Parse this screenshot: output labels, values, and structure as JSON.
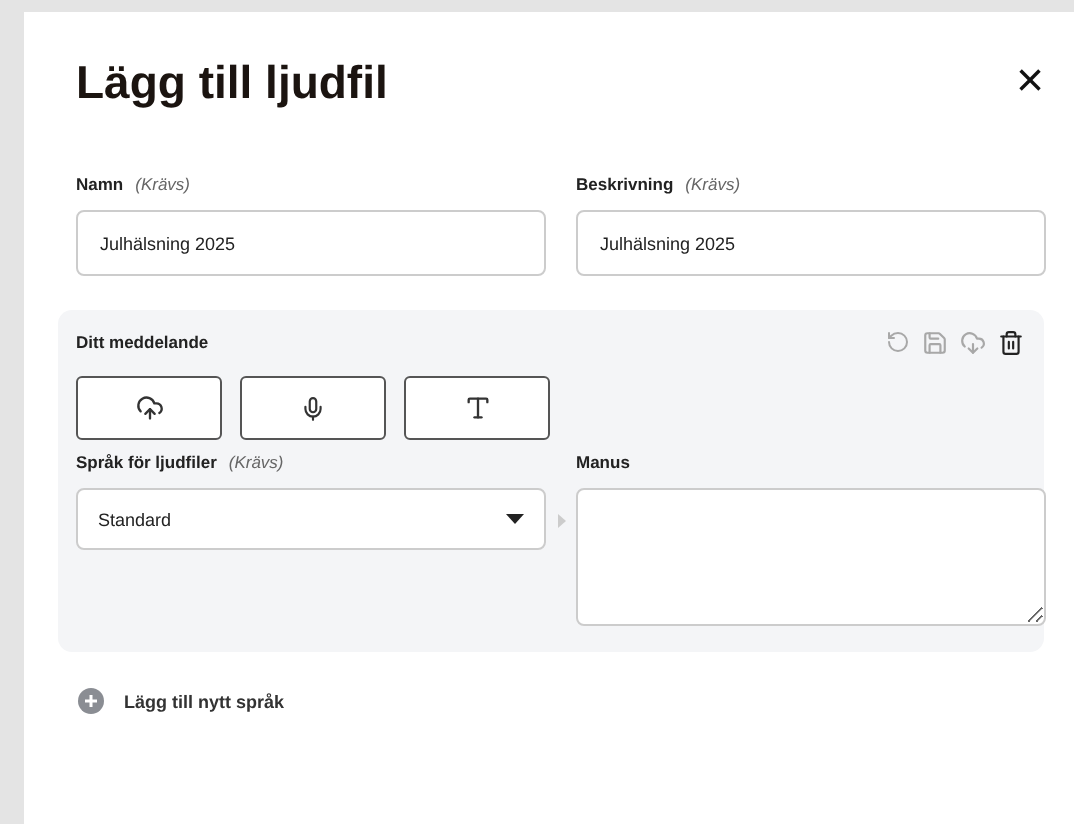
{
  "dialog": {
    "title": "Lägg till ljudfil",
    "close": "×"
  },
  "fields": [
    {
      "label": "Namn",
      "hint": "(Krävs)",
      "value": "Julhälsning 2025"
    },
    {
      "label": "Beskrivning",
      "hint": "(Krävs)",
      "value": "Julhälsning 2025"
    }
  ],
  "message": {
    "title": "Ditt meddelande",
    "actions": [
      {
        "kind": "undo",
        "disabled": true
      },
      {
        "kind": "save",
        "disabled": true
      },
      {
        "kind": "cloud",
        "disabled": true
      },
      {
        "kind": "trash",
        "disabled": false
      }
    ],
    "sources": [
      {
        "kind": "upload"
      },
      {
        "kind": "mic"
      },
      {
        "kind": "text"
      }
    ],
    "language": {
      "label": "Språk för ljudfiler",
      "hint": "(Krävs)",
      "value": "Standard"
    },
    "script": {
      "label": "Manus"
    }
  },
  "add_language": "Lägg till nytt språk"
}
